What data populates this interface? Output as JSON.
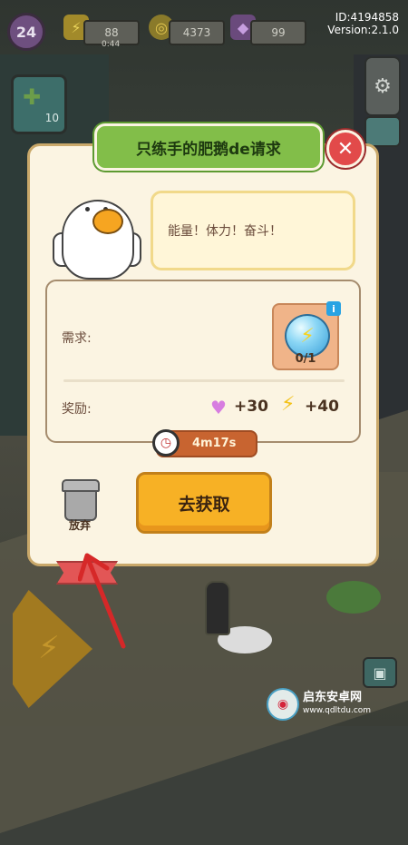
{
  "hud": {
    "level": "24",
    "energy": "88",
    "energy_timer": "0:44",
    "coins": "4373",
    "gems": "99",
    "id_text": "ID:4194858",
    "version_text": "Version:2.1.0"
  },
  "side": {
    "card_count": "10"
  },
  "dialog": {
    "title": "只练手的肥鹅de请求",
    "speech": "能量！体力！奋斗！",
    "requirement_label": "需求:",
    "requirement_count": "0/1",
    "reward_label": "奖励:",
    "reward_heart": "+30",
    "reward_energy": "+40",
    "timer": "4m17s",
    "abandon_label": "放弃",
    "get_button": "去获取"
  },
  "watermark": {
    "name": "启东安卓网",
    "url": "www.qdltdu.com"
  },
  "colors": {
    "title_green": "#82be49",
    "close_red": "#e24a4a",
    "button_yellow": "#f7b125",
    "panel_cream": "#fbf4e2",
    "arrow_red": "#d62828"
  }
}
